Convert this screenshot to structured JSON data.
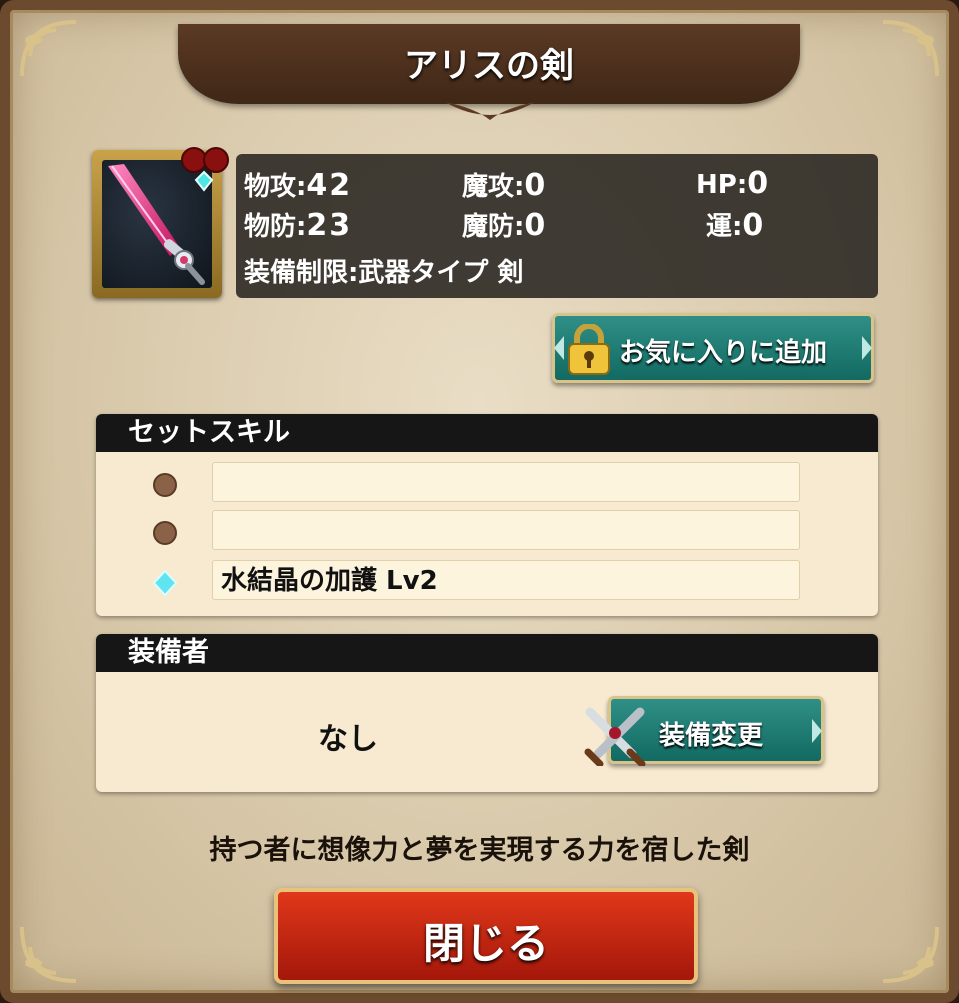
{
  "dialog": {
    "title": "アリスの剣"
  },
  "stats": {
    "phys_atk": {
      "label": "物攻",
      "sep": ":",
      "value": "42"
    },
    "mag_atk": {
      "label": "魔攻",
      "sep": ":",
      "value": "0"
    },
    "hp": {
      "label": "HP",
      "sep": ":",
      "value": "0"
    },
    "phys_def": {
      "label": "物防",
      "sep": ":",
      "value": "23"
    },
    "mag_def": {
      "label": "魔防",
      "sep": ":",
      "value": "0"
    },
    "luck": {
      "label": "運",
      "sep": ":",
      "value": "0"
    },
    "restriction": "装備制限:武器タイプ 剣"
  },
  "favorite_button": "お気に入りに追加",
  "set_skill": {
    "header": "セットスキル",
    "slots": [
      {
        "bullet": "brown-dot",
        "text": ""
      },
      {
        "bullet": "brown-dot",
        "text": ""
      },
      {
        "bullet": "cyan-crystal",
        "text": "水結晶の加護 Lv2"
      }
    ]
  },
  "equipper": {
    "header": "装備者",
    "value": "なし",
    "change_button": "装備変更"
  },
  "flavor_text": "持つ者に想像力と夢を実現する力を宿した剣",
  "close_button": "閉じる",
  "colors": {
    "title_banner": "#4a2e1c",
    "teal_button": "#1a7a72",
    "close_button": "#c8240f",
    "panel_bg": "#f7ead0",
    "stats_bg": "#28241f"
  },
  "icons": {
    "item": "pink-sword-icon",
    "gem": "cyan-gem-icon",
    "lock": "padlock-icon",
    "equip": "crossed-swords-icon"
  }
}
